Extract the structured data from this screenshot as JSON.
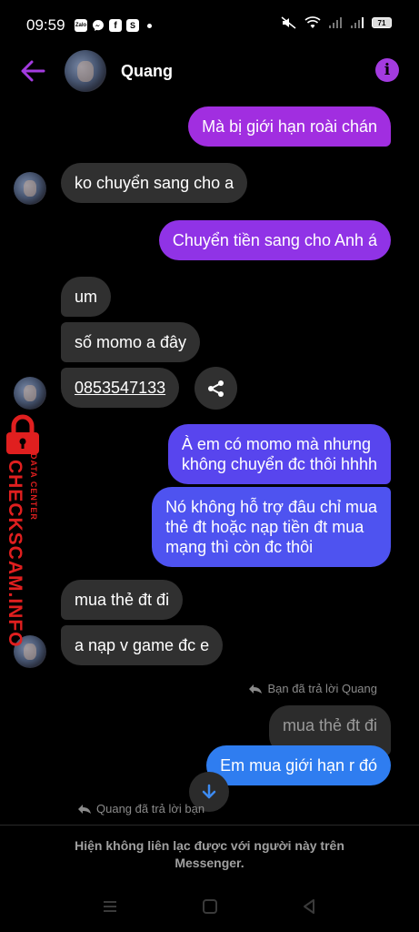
{
  "status_bar": {
    "time": "09:59",
    "apps": [
      "Zalo",
      "messenger",
      "facebook",
      "shopee"
    ],
    "battery": "71"
  },
  "header": {
    "contact_name": "Quang",
    "back_icon": "arrow-left-icon",
    "info_icon": "info-icon",
    "accent_color": "#a33be0"
  },
  "messages": [
    {
      "dir": "out",
      "text": "Mà bị giới hạn roài chán"
    },
    {
      "dir": "in",
      "text": "ko chuyển sang cho a"
    },
    {
      "dir": "out",
      "text": "Chuyển tiền sang cho Anh á"
    },
    {
      "dir": "in",
      "text": "um"
    },
    {
      "dir": "in",
      "text": "số momo a đây"
    },
    {
      "dir": "in",
      "text": "0853547133"
    },
    {
      "dir": "out",
      "text": "À em có momo mà nhưng\nkhông chuyển đc thôi hhhh"
    },
    {
      "dir": "out",
      "text": "Nó không hỗ trợ đâu chỉ mua\nthẻ đt hoặc nạp tiền đt mua\nmạng thì còn đc thôi"
    },
    {
      "dir": "in",
      "text": "mua thẻ đt đi"
    },
    {
      "dir": "in",
      "text": "a nạp v game đc e"
    },
    {
      "dir": "out-quoted",
      "text": "mua thẻ đt đi"
    },
    {
      "dir": "out",
      "text": "Em mua giới hạn r đó"
    }
  ],
  "reply_notes": {
    "you_replied": "Bạn đã trả lời Quang",
    "quang_replied": "Quang đã trả lời bạn"
  },
  "footer": {
    "blocked_message": "Hiện không liên lạc được với người này trên\nMessenger."
  },
  "watermark": {
    "brand": "CHECKSCAM.INFO",
    "sub": "DATA CENTER"
  },
  "colors": {
    "outgoing_top": "#a12ee0",
    "outgoing_mid": "#6a40f0",
    "outgoing_bottom": "#2f7df0",
    "incoming": "#303030",
    "watermark": "#e01f1f"
  }
}
